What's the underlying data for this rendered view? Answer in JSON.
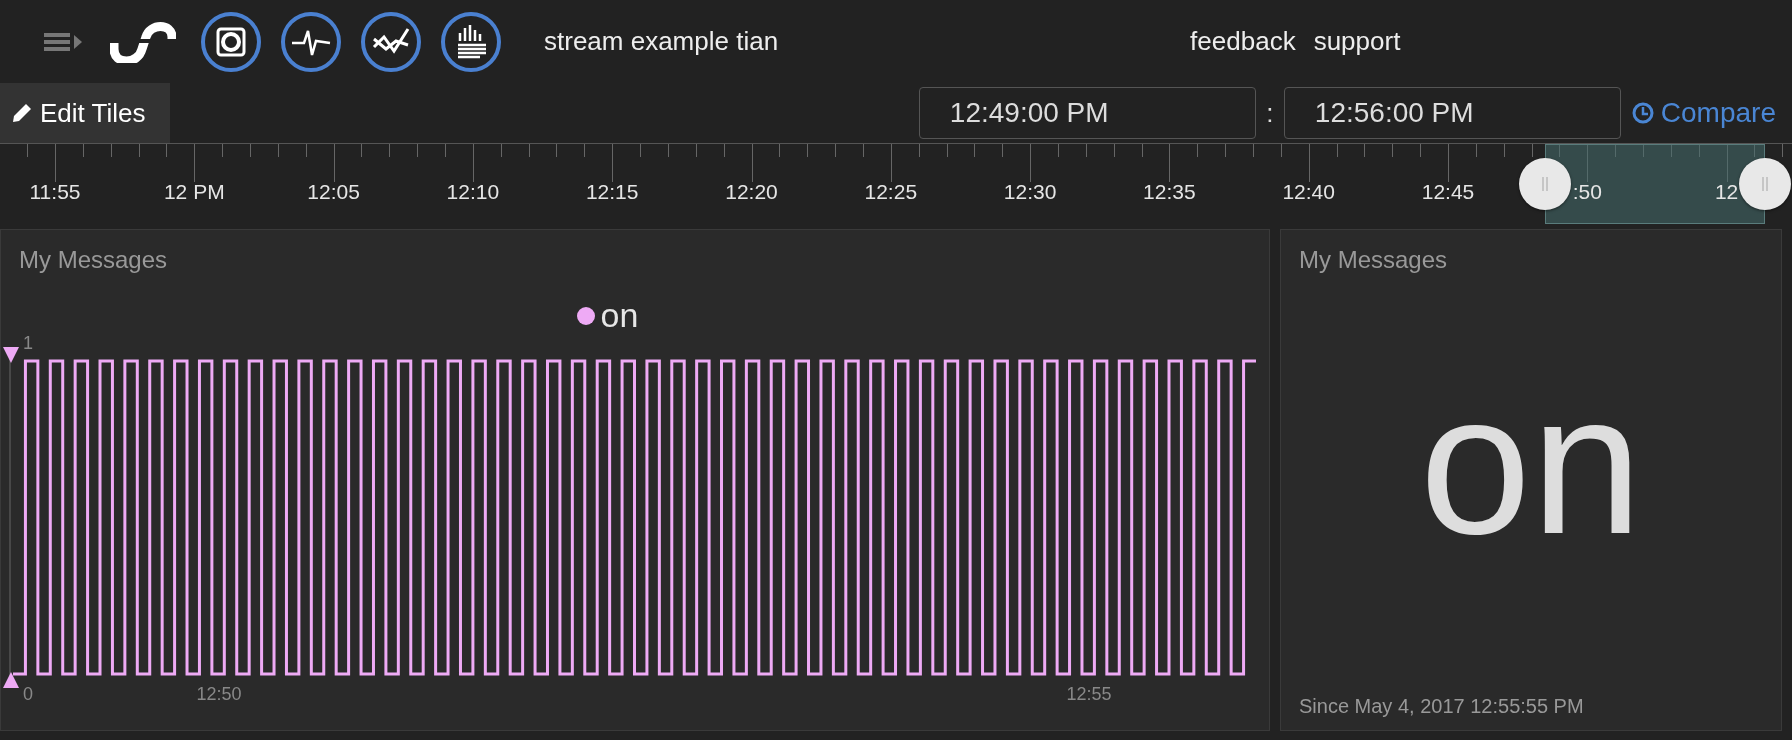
{
  "header": {
    "title": "stream example tian",
    "links": [
      "feedback",
      "support"
    ]
  },
  "toolbar": {
    "edit_button": "Edit Tiles",
    "start_time": "12:49:00 PM",
    "separator": ":",
    "end_time": "12:56:00 PM",
    "compare_link": "Compare"
  },
  "timeline": {
    "labels": [
      "11:55",
      "12 PM",
      "12:05",
      "12:10",
      "12:15",
      "12:20",
      "12:25",
      "12:30",
      "12:35",
      "12:40",
      "12:45",
      ":50",
      "12"
    ]
  },
  "tiles": [
    {
      "kind": "chart",
      "title": "My Messages",
      "legend": [
        {
          "label": "on",
          "color": "#eeaaf5"
        }
      ],
      "y_labels": [
        "1",
        "0"
      ],
      "x_labels": [
        "12:50",
        "12:55"
      ]
    },
    {
      "kind": "value",
      "title": "My Messages",
      "value": "on",
      "since": "Since May 4, 2017 12:55:55 PM"
    }
  ]
}
